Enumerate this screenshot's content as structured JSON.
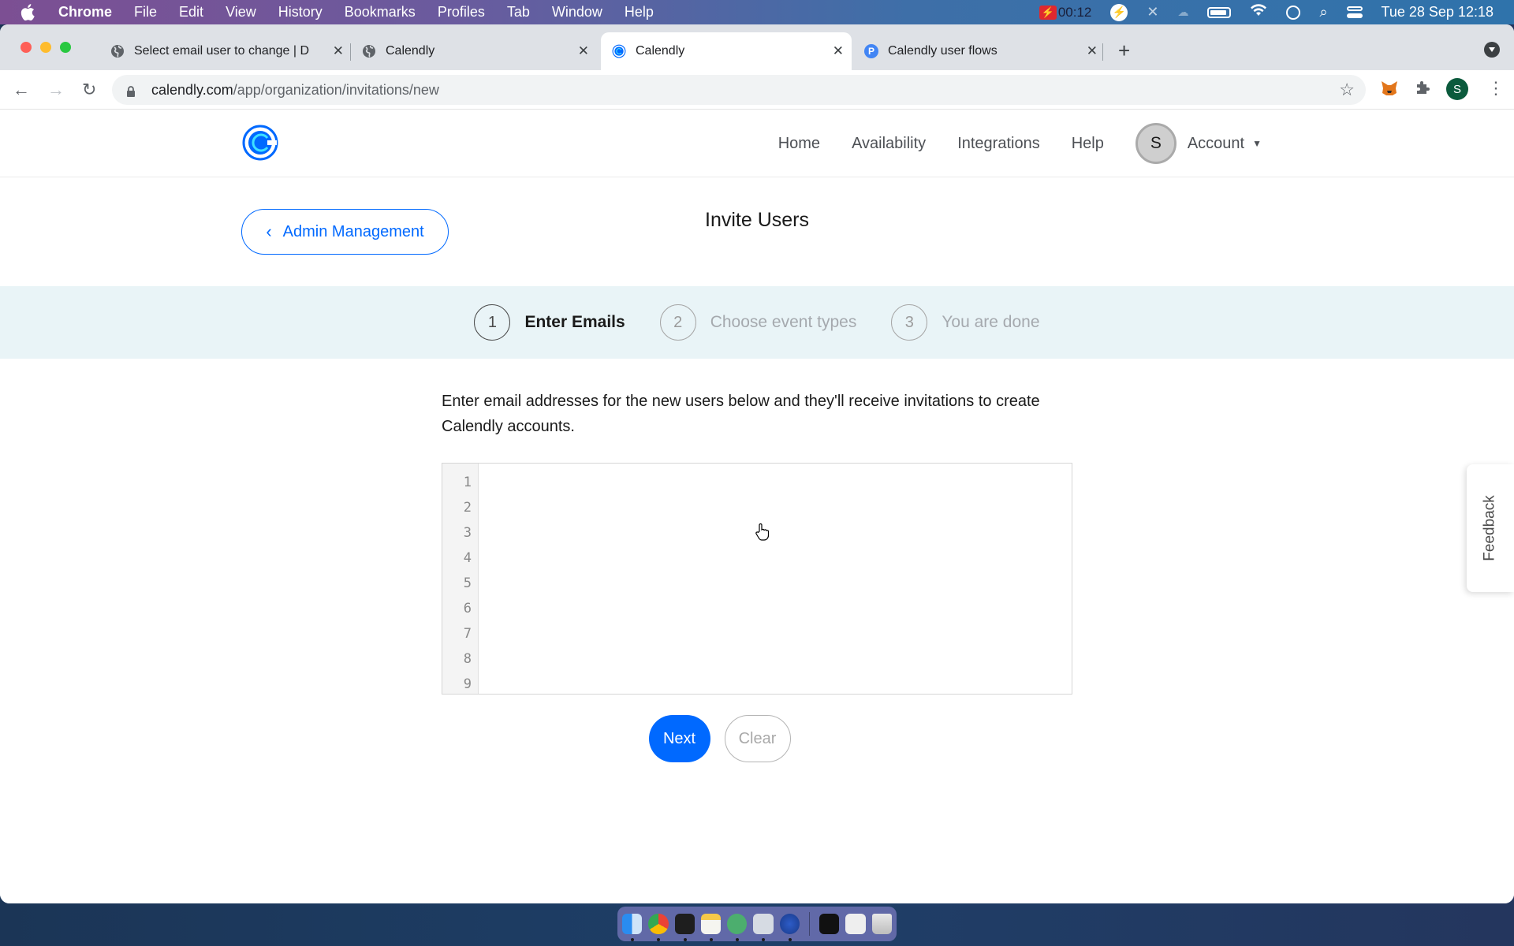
{
  "menubar": {
    "app_name": "Chrome",
    "items": [
      "File",
      "Edit",
      "View",
      "History",
      "Bookmarks",
      "Profiles",
      "Tab",
      "Window",
      "Help"
    ],
    "recording_time": "00:12",
    "datetime": "Tue 28 Sep  12:18"
  },
  "browser": {
    "tabs": [
      {
        "title": "Select email user to change | D",
        "icon": "globe-icon",
        "active": false
      },
      {
        "title": "Calendly",
        "icon": "globe-icon",
        "active": false
      },
      {
        "title": "Calendly",
        "icon": "calendly-icon",
        "active": true
      },
      {
        "title": "Calendly user flows",
        "icon": "p-icon",
        "active": false
      }
    ],
    "new_tab_label": "+",
    "url_domain": "calendly.com",
    "url_path": "/app/organization/invitations/new",
    "profile_initial": "S"
  },
  "header": {
    "nav": [
      "Home",
      "Availability",
      "Integrations",
      "Help"
    ],
    "avatar_initial": "S",
    "account_label": "Account"
  },
  "page": {
    "back_label": "Admin Management",
    "title": "Invite Users",
    "steps": [
      {
        "num": "1",
        "label": "Enter Emails",
        "active": true
      },
      {
        "num": "2",
        "label": "Choose event types",
        "active": false
      },
      {
        "num": "3",
        "label": "You are done",
        "active": false
      }
    ],
    "intro": "Enter email addresses for the new users below and they'll receive invitations to create Calendly accounts.",
    "line_numbers": [
      "1",
      "2",
      "3",
      "4",
      "5",
      "6",
      "7",
      "8",
      "9"
    ],
    "editor_value": "",
    "next_label": "Next",
    "clear_label": "Clear",
    "feedback_label": "Feedback"
  },
  "colors": {
    "brand_blue": "#0069ff",
    "steps_bg": "#e9f4f7"
  },
  "dock": [
    "Finder",
    "Chrome",
    "Terminal",
    "Notes",
    "Atom",
    "1Password",
    "Reeder",
    "Screenshot",
    "Preview",
    "Trash"
  ]
}
